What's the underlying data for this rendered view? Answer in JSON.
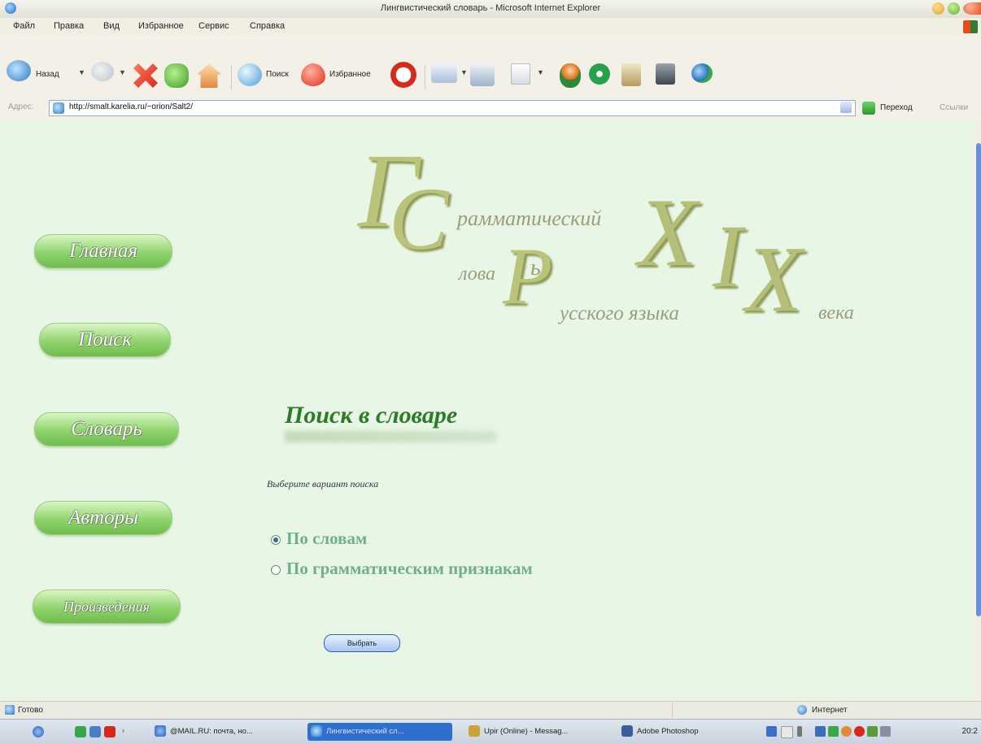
{
  "window": {
    "title": "Лингвистический словарь - Microsoft Internet Explorer"
  },
  "menu": [
    "Файл",
    "Правка",
    "Вид",
    "Избранное",
    "Сервис",
    "Справка"
  ],
  "toolbar": {
    "back": "Назад",
    "search": "Поиск",
    "favorites": "Избранное"
  },
  "address": {
    "label": "Адрес:",
    "url": "http://smalt.karelia.ru/~orion/Salt2/",
    "go": "Переход",
    "links": "Ссылки"
  },
  "nav": [
    "Главная",
    "Поиск",
    "Словарь",
    "Авторы",
    "Произведения"
  ],
  "logo": {
    "g": "Г",
    "c": "С",
    "r": "Р",
    "x1": "X",
    "i": "I",
    "x2": "X",
    "rammat": "рамматический",
    "lova": "лова",
    "b": "ь",
    "usskogo": "усского языка",
    "veka": "века"
  },
  "search": {
    "heading": "Поиск в словаре",
    "subtitle": "Выберите вариант поиска",
    "options": [
      {
        "label": "По словам",
        "checked": true
      },
      {
        "label": "По грамматическим признакам",
        "checked": false
      }
    ],
    "submit": "Выбрать"
  },
  "status": {
    "text": "Готово",
    "zone": "Интернет"
  },
  "taskbar": {
    "tasks": [
      "@MAIL.RU: почта, но...",
      "Лингвистический сл...",
      "Upir (Online) - Messag...",
      "Adobe Photoshop"
    ],
    "clock": "20:2"
  },
  "colors": {
    "accent": "#2c7a2a",
    "nav_green": "#8fd36d",
    "logo": "#b9c47a"
  }
}
